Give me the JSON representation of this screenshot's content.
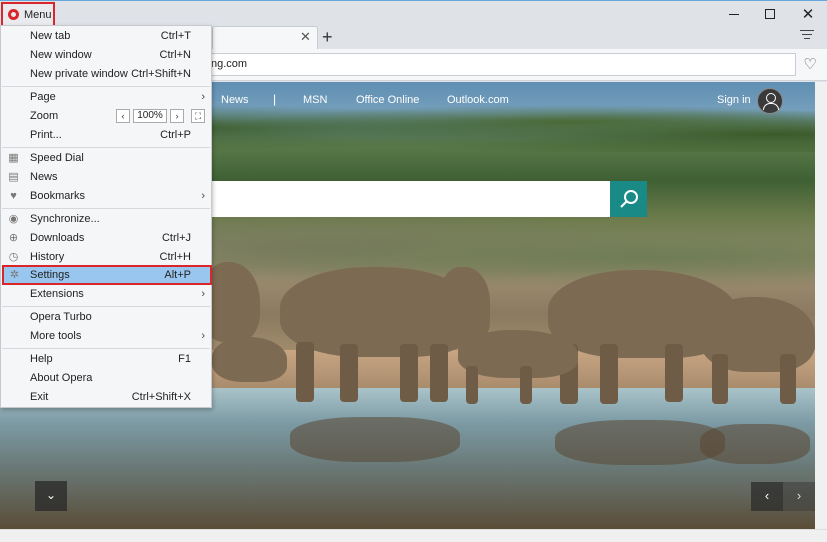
{
  "titlebar": {
    "menu_label": "Menu",
    "minimize_glyph": "—",
    "maximize_glyph": "□",
    "close_glyph": "✕"
  },
  "tabs": {
    "close_glyph": "✕",
    "new_tab_glyph": "+"
  },
  "address": {
    "url_text": "ng.com",
    "heart_glyph": "♡"
  },
  "menu": {
    "items": [
      {
        "label": "New tab",
        "shortcut": "Ctrl+T"
      },
      {
        "label": "New window",
        "shortcut": "Ctrl+N"
      },
      {
        "label": "New private window",
        "shortcut": "Ctrl+Shift+N"
      },
      {
        "label": "Page",
        "arrow": "›"
      },
      {
        "label": "Zoom",
        "zoom_value": "100%",
        "zoom_out": "‹",
        "zoom_in": "›",
        "fullscreen": "⛶"
      },
      {
        "label": "Print...",
        "shortcut": "Ctrl+P"
      },
      {
        "label": "Speed Dial",
        "icon": "grid-icon"
      },
      {
        "label": "News",
        "icon": "news-icon"
      },
      {
        "label": "Bookmarks",
        "icon": "heart-icon",
        "arrow": "›"
      },
      {
        "label": "Synchronize...",
        "icon": "person-icon"
      },
      {
        "label": "Downloads",
        "icon": "download-icon",
        "shortcut": "Ctrl+J"
      },
      {
        "label": "History",
        "icon": "clock-icon",
        "shortcut": "Ctrl+H"
      },
      {
        "label": "Settings",
        "icon": "gear-icon",
        "shortcut": "Alt+P"
      },
      {
        "label": "Extensions",
        "arrow": "›"
      },
      {
        "label": "Opera Turbo"
      },
      {
        "label": "More tools",
        "arrow": "›"
      },
      {
        "label": "Help",
        "shortcut": "F1"
      },
      {
        "label": "About Opera"
      },
      {
        "label": "Exit",
        "shortcut": "Ctrl+Shift+X"
      }
    ]
  },
  "page": {
    "nav": {
      "news": "News",
      "separator": "|",
      "msn": "MSN",
      "office": "Office Online",
      "outlook": "Outlook.com"
    },
    "signin": "Sign in",
    "scroll_down_glyph": "⌄",
    "prev_glyph": "‹",
    "next_glyph": "›"
  },
  "colors": {
    "highlight_border": "#d9262a",
    "selected_item": "#99c6ee",
    "search_button": "#1a8a87"
  }
}
